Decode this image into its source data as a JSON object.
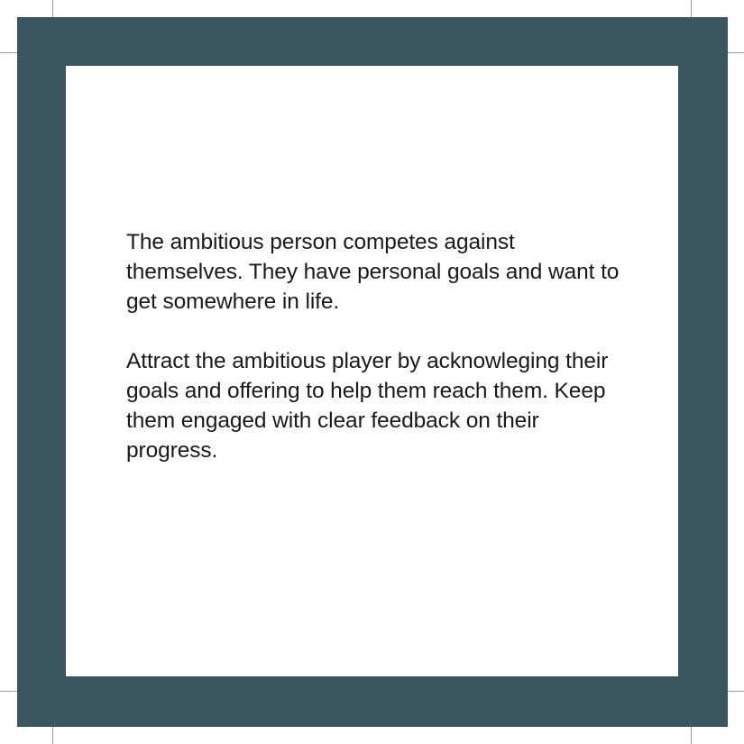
{
  "card": {
    "border_color": "#3a5661",
    "background_color": "#ffffff",
    "paragraphs": [
      "The ambitious person competes against themselves. They have personal goals and want to get somewhere in life.",
      "Attract the ambitious player by acknowleging their goals and offering to help them reach them. Keep them engaged with clear feedback on their progress."
    ]
  },
  "crop_marks": {
    "color": "#9a9a9a"
  }
}
